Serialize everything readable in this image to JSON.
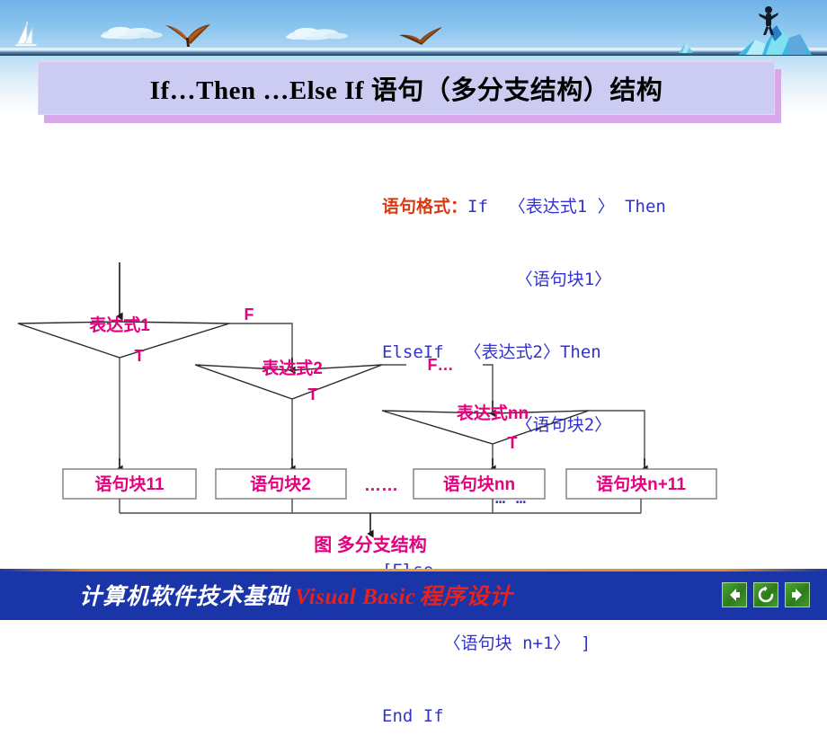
{
  "banner": {
    "scene_items": [
      {
        "name": "sailboat-icon"
      },
      {
        "name": "cloud-icon"
      },
      {
        "name": "bird-icon"
      },
      {
        "name": "cloud-icon"
      },
      {
        "name": "bird-icon"
      },
      {
        "name": "iceberg-icon"
      },
      {
        "name": "climber-figure-icon"
      }
    ]
  },
  "title": {
    "text": "If…Then …Else If 语句（多分支结构）结构",
    "plate_color": "#CCCCF2",
    "shadow_color": "#D9A8E8"
  },
  "code": {
    "label": "语句格式：",
    "label_color": "#D93A12",
    "text_color": "#3333CC",
    "lines": [
      "If  〈表达式1 〉 Then",
      "             〈语句块1〉",
      "ElseIf  〈表达式2〉Then",
      "             〈语句块2〉",
      "           … …",
      "[Else",
      "      〈语句块 n+1〉 ]",
      "End If"
    ]
  },
  "flowchart": {
    "accent_color": "#E6007E",
    "caption": "图   多分支结构",
    "decisions": [
      {
        "label": "表达式1",
        "true_label": "T",
        "false_label": "F"
      },
      {
        "label": "表达式2",
        "true_label": "T",
        "false_label": "F…"
      },
      {
        "label": "表达式nn",
        "true_label": "T",
        "false_label": ""
      }
    ],
    "process_boxes": [
      {
        "label": "语句块11"
      },
      {
        "label": "语句块2"
      },
      {
        "label": "语句块nn"
      },
      {
        "label": "语句块n+11"
      }
    ],
    "ellipsis": "……"
  },
  "footer": {
    "course_name": "计算机软件技术基础",
    "product_name": "Visual Basic",
    "subtitle": "程序设计",
    "background": "#1A35A8",
    "buttons": [
      {
        "name": "back-button",
        "icon": "arrow-left-icon"
      },
      {
        "name": "replay-button",
        "icon": "refresh-icon"
      },
      {
        "name": "forward-button",
        "icon": "arrow-right-icon"
      }
    ]
  }
}
